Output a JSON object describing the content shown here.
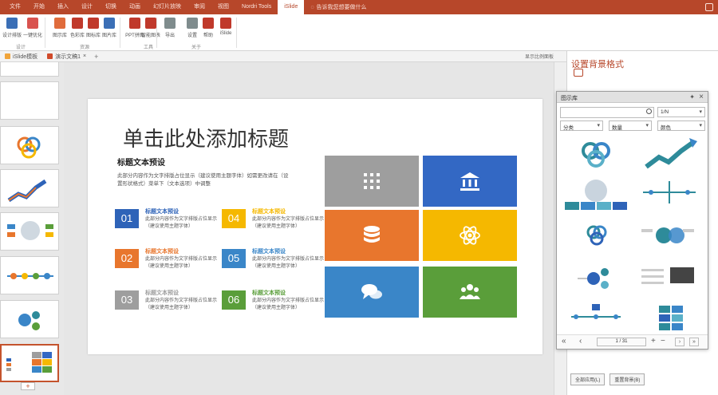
{
  "ribbon_tabs": [
    "文件",
    "开始",
    "插入",
    "设计",
    "切换",
    "动画",
    "幻灯片放映",
    "审阅",
    "视图",
    "Nordri Tools",
    "iSlide"
  ],
  "active_tab_index": 10,
  "tell_me": "告诉我您想要做什么",
  "ribbon": {
    "buttons": [
      {
        "label": "设计排版",
        "color": "#3b6fb6"
      },
      {
        "label": "一键优化",
        "color": "#d9534f"
      },
      {
        "label": "图示库",
        "color": "#e06c3c"
      },
      {
        "label": "色彩库",
        "color": "#c0392b"
      },
      {
        "label": "图标库",
        "color": "#c0392b"
      },
      {
        "label": "图片库",
        "color": "#3b6fb6"
      },
      {
        "label": "PPT拼图",
        "color": "#c0392b"
      },
      {
        "label": "智能图表",
        "color": "#c0392b"
      },
      {
        "label": "导出",
        "color": "#7f8c8d"
      },
      {
        "label": "设置",
        "color": "#7f8c8d"
      },
      {
        "label": "帮助",
        "color": "#c0392b"
      },
      {
        "label": "iSlide",
        "color": "#c0392b"
      }
    ],
    "groups": [
      "设计",
      "资源",
      "工具",
      "关于"
    ]
  },
  "doc_tabs": [
    {
      "label": "iSlide模板"
    },
    {
      "label": "演示文稿1"
    }
  ],
  "doc_bar_right": "显示比例面板",
  "slide": {
    "title": "单击此处添加标题",
    "subtitle": "标题文本预设",
    "description": "此部分内容作为文字排版占位显示（建议使用主题字体）如需更改请在（设置形状格式）菜单下（文本选项）中调整",
    "items": [
      {
        "num": "01",
        "title": "标题文本预设",
        "text": "此部分内容作为文字排版占位显示（建议使用主题字体）",
        "color": "#2e63b8",
        "title_color": "#2e63b8"
      },
      {
        "num": "02",
        "title": "标题文本预设",
        "text": "此部分内容作为文字排版占位显示（建议使用主题字体）",
        "color": "#e8762d",
        "title_color": "#e8762d"
      },
      {
        "num": "03",
        "title": "标题文本预设",
        "text": "此部分内容作为文字排版占位显示（建议使用主题字体）",
        "color": "#9e9e9e",
        "title_color": "#9e9e9e"
      },
      {
        "num": "04",
        "title": "标题文本预设",
        "text": "此部分内容作为文字排版占位显示（建议使用主题字体）",
        "color": "#f5b800",
        "title_color": "#f5b800"
      },
      {
        "num": "05",
        "title": "标题文本预设",
        "text": "此部分内容作为文字排版占位显示（建议使用主题字体）",
        "color": "#3a86c8",
        "title_color": "#3a86c8"
      },
      {
        "num": "06",
        "title": "标题文本预设",
        "text": "此部分内容作为文字排版占位显示（建议使用主题字体）",
        "color": "#5a9e3a",
        "title_color": "#5a9e3a"
      }
    ],
    "tiles": [
      {
        "icon": "grid-icon",
        "color": "#9e9e9e"
      },
      {
        "icon": "bank-icon",
        "color": "#3368c4"
      },
      {
        "icon": "database-icon",
        "color": "#e8762d"
      },
      {
        "icon": "atom-icon",
        "color": "#f5b800"
      },
      {
        "icon": "chat-icon",
        "color": "#3a86c8"
      },
      {
        "icon": "users-icon",
        "color": "#5a9e3a"
      }
    ]
  },
  "side_pane": {
    "title": "设置背景格式",
    "buttons": [
      "全部应用(L)",
      "重置背景(B)"
    ]
  },
  "library": {
    "title": "图示库",
    "search_value": "",
    "filter_count": "1/N",
    "filters": [
      "分类",
      "数量",
      "颜色"
    ],
    "page": "1 / 31"
  },
  "colors": {
    "accent": "#b7472a"
  }
}
